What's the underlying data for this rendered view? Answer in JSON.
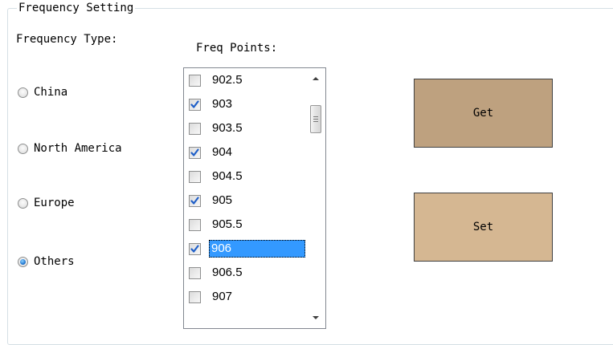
{
  "group": {
    "title": "Frequency Setting"
  },
  "frequency_type": {
    "label": "Frequency Type:",
    "options": [
      {
        "label": "China",
        "checked": false
      },
      {
        "label": "North America",
        "checked": false
      },
      {
        "label": "Europe",
        "checked": false
      },
      {
        "label": "Others",
        "checked": true
      }
    ]
  },
  "freq_points": {
    "label": "Freq Points:",
    "items": [
      {
        "label": "902.5",
        "checked": false,
        "selected": false
      },
      {
        "label": "903",
        "checked": true,
        "selected": false
      },
      {
        "label": "903.5",
        "checked": false,
        "selected": false
      },
      {
        "label": "904",
        "checked": true,
        "selected": false
      },
      {
        "label": "904.5",
        "checked": false,
        "selected": false
      },
      {
        "label": "905",
        "checked": true,
        "selected": false
      },
      {
        "label": "905.5",
        "checked": false,
        "selected": false
      },
      {
        "label": "906",
        "checked": true,
        "selected": true
      },
      {
        "label": "906.5",
        "checked": false,
        "selected": false
      },
      {
        "label": "907",
        "checked": false,
        "selected": false
      }
    ]
  },
  "buttons": {
    "get_label": "Get",
    "get_color": "#bea17f",
    "set_label": "Set",
    "set_color": "#d5b792"
  },
  "colors": {
    "selection": "#3399ff",
    "check": "#1f5fc8"
  }
}
